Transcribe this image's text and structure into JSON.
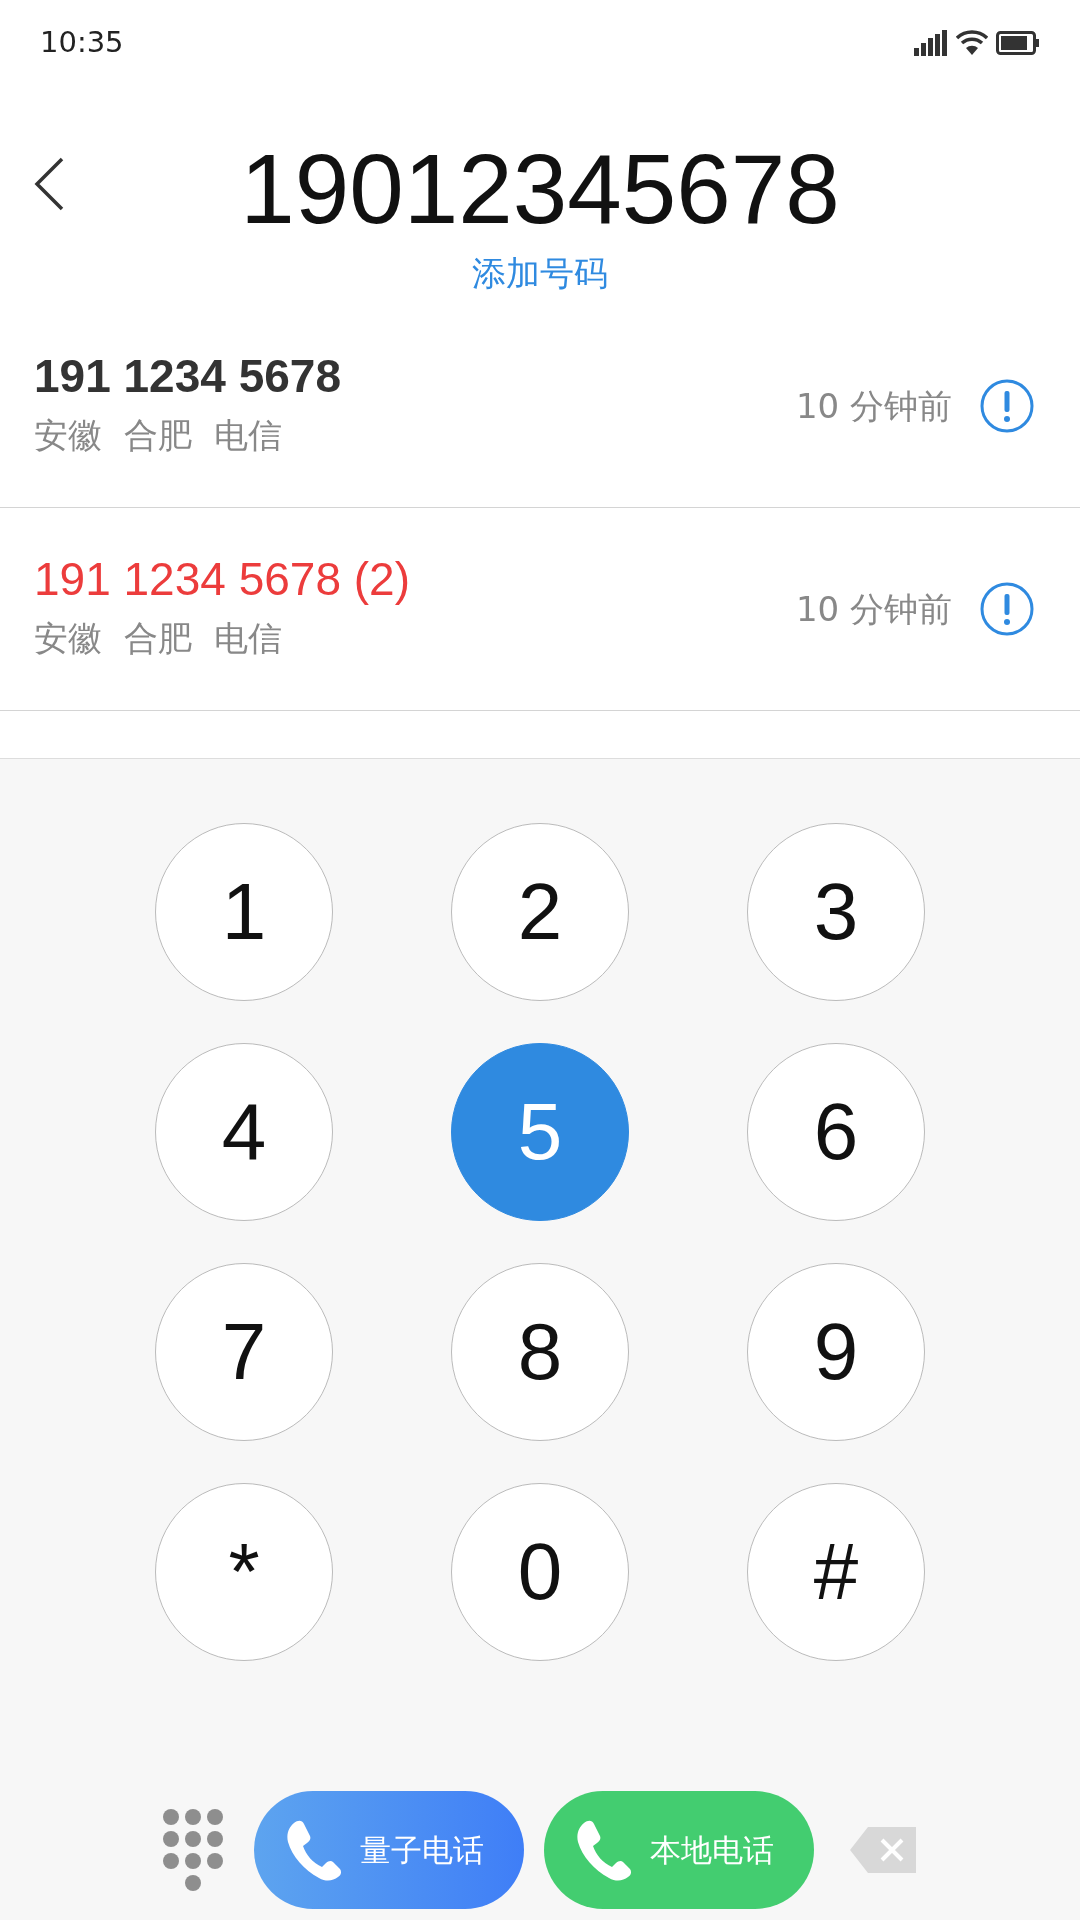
{
  "status_bar": {
    "time": "10:35"
  },
  "header": {
    "number": "19012345678",
    "add_link": "添加号码"
  },
  "calls": [
    {
      "number": "191 1234 5678",
      "missed": false,
      "location": [
        "安徽",
        "合肥",
        "电信"
      ],
      "time": "10 分钟前"
    },
    {
      "number": "191 1234 5678 (2)",
      "missed": true,
      "location": [
        "安徽",
        "合肥",
        "电信"
      ],
      "time": "10 分钟前"
    }
  ],
  "keypad": [
    {
      "label": "1",
      "selected": false
    },
    {
      "label": "2",
      "selected": false
    },
    {
      "label": "3",
      "selected": false
    },
    {
      "label": "4",
      "selected": false
    },
    {
      "label": "5",
      "selected": true
    },
    {
      "label": "6",
      "selected": false
    },
    {
      "label": "7",
      "selected": false
    },
    {
      "label": "8",
      "selected": false
    },
    {
      "label": "9",
      "selected": false
    },
    {
      "label": "*",
      "selected": false
    },
    {
      "label": "0",
      "selected": false
    },
    {
      "label": "#",
      "selected": false
    }
  ],
  "call_buttons": [
    {
      "label": "量子电话",
      "kind": "quantum"
    },
    {
      "label": "本地电话",
      "kind": "local"
    }
  ]
}
